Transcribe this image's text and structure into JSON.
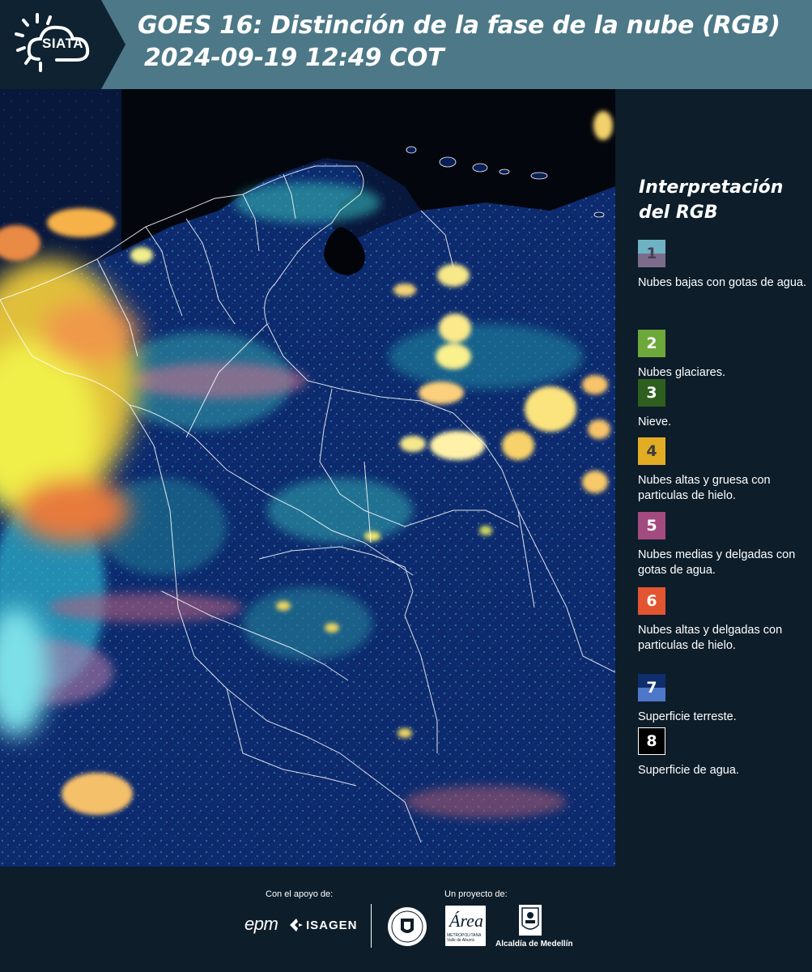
{
  "header": {
    "logo_text": "SIATA",
    "title": "GOES 16: Distinción de la fase de la nube (RGB)",
    "subtitle": "2024-09-19 12:49 COT"
  },
  "legend": {
    "title": "Interpretación del RGB",
    "items": [
      {
        "num": "1",
        "label": "Nubes bajas con gotas de agua.",
        "color_top": "#6eb3c4",
        "color_bottom": "#7b6c8c",
        "text_color": "#4a3e55"
      },
      {
        "num": "2",
        "label": "Nubes glaciares.",
        "color_top": "#6da83a",
        "color_bottom": "#6da83a",
        "text_color": "#ffffff"
      },
      {
        "num": "3",
        "label": "Nieve.",
        "color_top": "#2f5f1e",
        "color_bottom": "#2f5f1e",
        "text_color": "#ffffff"
      },
      {
        "num": "4",
        "label": "Nubes altas y gruesa con particulas de hielo.",
        "color_top": "#e2ad24",
        "color_bottom": "#e2ad24",
        "text_color": "#3c3c3c"
      },
      {
        "num": "5",
        "label": "Nubes medias y delgadas con gotas de agua.",
        "color_top": "#a34a80",
        "color_bottom": "#a34a80",
        "text_color": "#ffffff"
      },
      {
        "num": "6",
        "label": "Nubes altas y delgadas con particulas de hielo.",
        "color_top": "#e35530",
        "color_bottom": "#e35530",
        "text_color": "#ffffff"
      },
      {
        "num": "7",
        "label": "Superficie terreste.",
        "color_top": "#0f2e6c",
        "color_bottom": "#4d77c9",
        "text_color": "#ffffff"
      },
      {
        "num": "8",
        "label": "Superficie de agua.",
        "color_top": "#000000",
        "color_bottom": "#000000",
        "text_color": "#ffffff"
      }
    ]
  },
  "footer": {
    "support_label": "Con el apoyo de:",
    "project_label": "Un proyecto de:",
    "epm": "epm",
    "isagen": "ISAGEN",
    "area_name": "Área",
    "area_sub": "METROPOLITANA\nValle de Aburrá",
    "alcaldia": "Alcaldía de Medellín"
  },
  "colors": {
    "header_bg": "#4c7887",
    "panel_bg": "#0d1d2a",
    "logo_bg": "#0e2231"
  }
}
